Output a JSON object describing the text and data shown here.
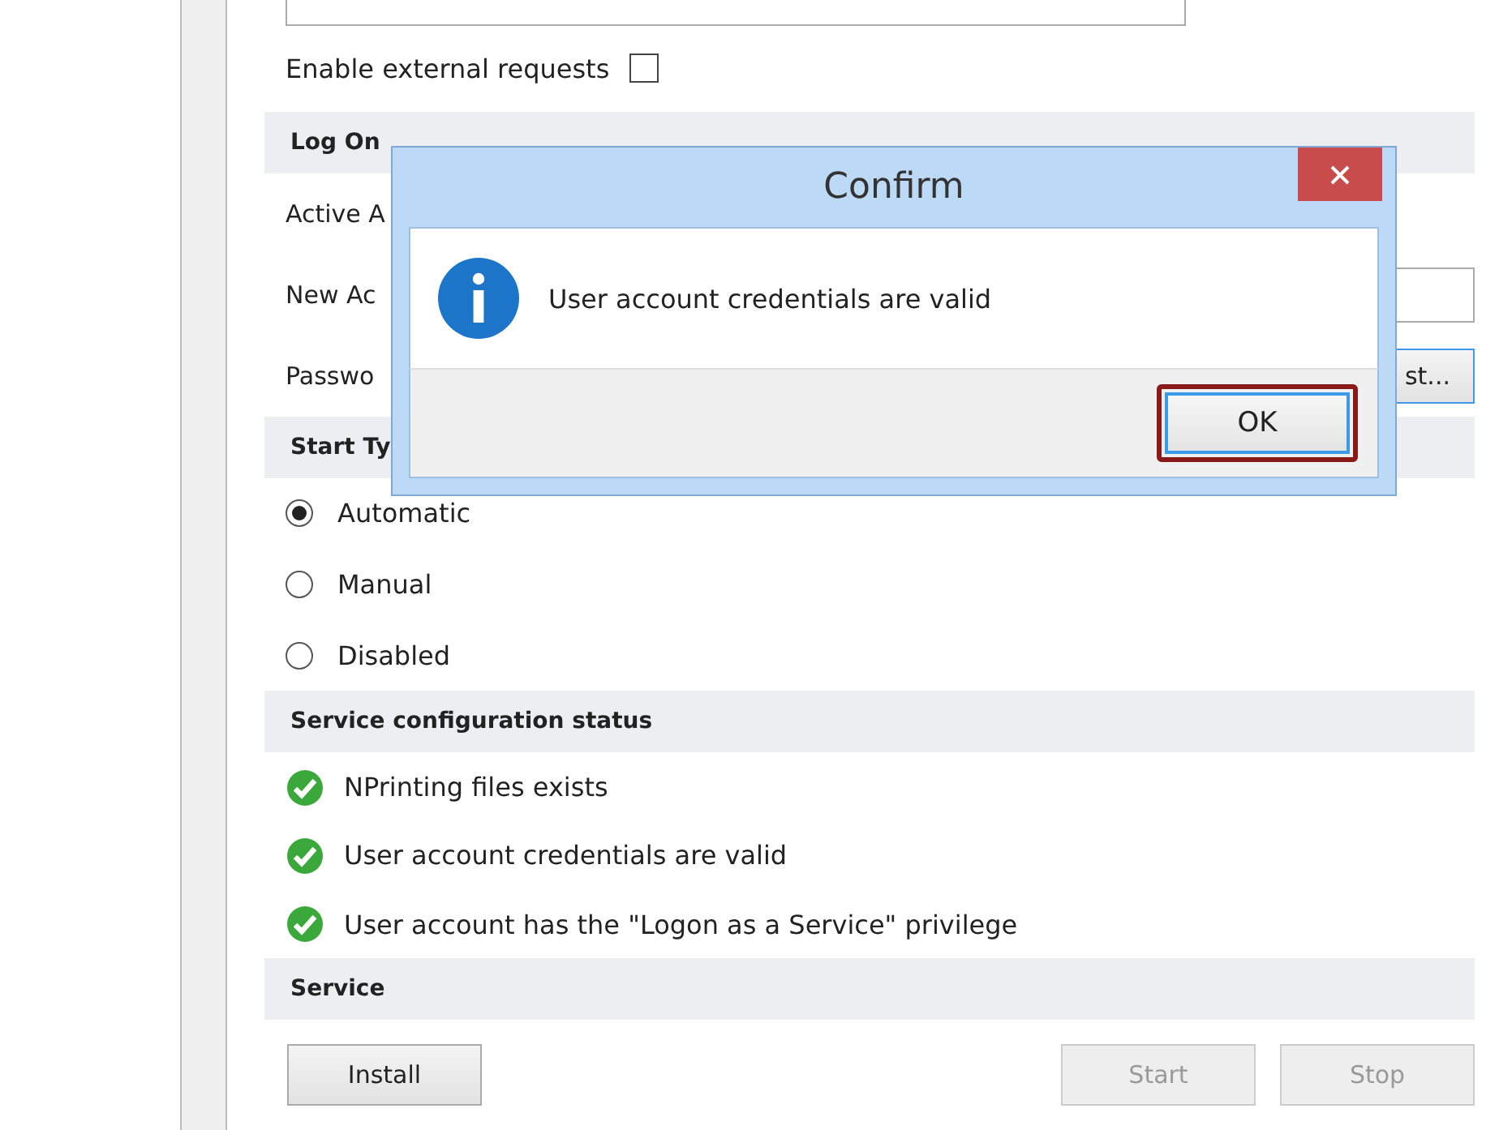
{
  "external_requests": {
    "label": "Enable external requests",
    "checked": false
  },
  "log_on": {
    "heading": "Log On",
    "active_account_label": "Active A",
    "new_account_label": "New Ac",
    "password_label": "Passwo",
    "test_button": "st..."
  },
  "start_type": {
    "heading": "Start Ty",
    "options": [
      {
        "label": "Automatic",
        "selected": true
      },
      {
        "label": "Manual",
        "selected": false
      },
      {
        "label": "Disabled",
        "selected": false
      }
    ]
  },
  "config_status": {
    "heading": "Service configuration status",
    "items": [
      {
        "label": "NPrinting files exists",
        "ok": true
      },
      {
        "label": "User account credentials are valid",
        "ok": true
      },
      {
        "label": "User account has the \"Logon as a Service\" privilege",
        "ok": true
      }
    ]
  },
  "service": {
    "heading": "Service",
    "buttons": [
      {
        "label": "Install",
        "disabled": false
      },
      {
        "label": "Start",
        "disabled": true
      },
      {
        "label": "Stop",
        "disabled": true
      }
    ]
  },
  "dialog": {
    "title": "Confirm",
    "message": "User account credentials are valid",
    "ok_button": "OK"
  }
}
